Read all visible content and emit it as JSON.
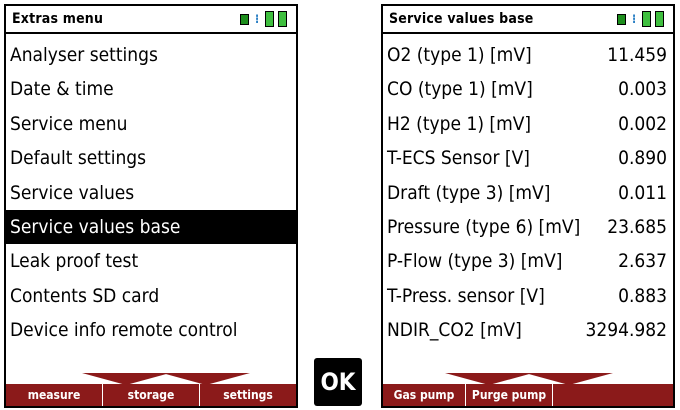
{
  "left_screen": {
    "title": "Extras menu",
    "items": [
      {
        "label": "Analyser settings"
      },
      {
        "label": "Date & time"
      },
      {
        "label": "Service menu"
      },
      {
        "label": "Default settings"
      },
      {
        "label": "Service values"
      },
      {
        "label": "Service values base"
      },
      {
        "label": "Leak proof test"
      },
      {
        "label": "Contents SD card"
      },
      {
        "label": "Device info remote control"
      }
    ],
    "selected_index": 5,
    "softkeys": [
      "measure",
      "storage",
      "settings"
    ]
  },
  "right_screen": {
    "title": "Service values base",
    "rows": [
      {
        "label": "O2 (type 1) [mV]",
        "value": "11.459"
      },
      {
        "label": "CO (type 1) [mV]",
        "value": "0.003"
      },
      {
        "label": "H2 (type 1) [mV]",
        "value": "0.002"
      },
      {
        "label": "T-ECS Sensor [V]",
        "value": "0.890"
      },
      {
        "label": "Draft (type 3) [mV]",
        "value": "0.011"
      },
      {
        "label": "Pressure (type 6) [mV]",
        "value": "23.685"
      },
      {
        "label": "P-Flow (type 3) [mV]",
        "value": "2.637"
      },
      {
        "label": "T-Press. sensor [V]",
        "value": "0.883"
      },
      {
        "label": "NDIR_CO2 [mV]",
        "value": "3294.982"
      }
    ],
    "softkeys": [
      "Gas pump",
      "Purge pump",
      ""
    ]
  },
  "ok_key": {
    "label": "OK"
  },
  "colors": {
    "softbar": "#8b1a1a",
    "battery": "#3fbf3f",
    "signal": "#2a7fc4"
  },
  "icons": [
    "device-status-icon",
    "wireless-signal-icon",
    "battery-icon"
  ]
}
